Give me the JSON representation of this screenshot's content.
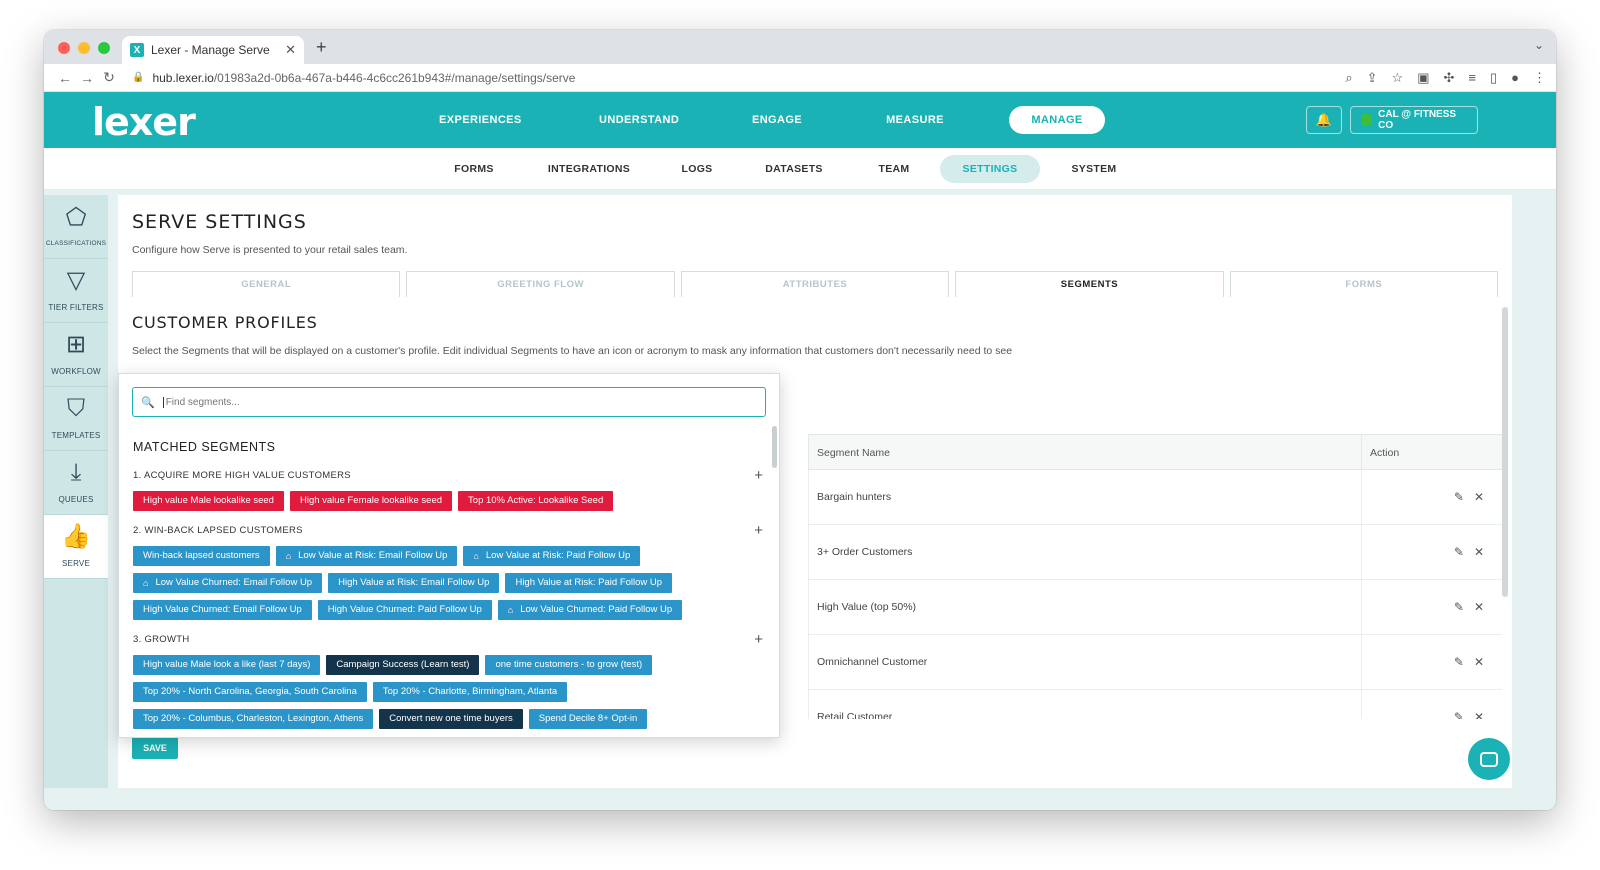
{
  "browser": {
    "tab_title": "Lexer - Manage Serve",
    "favicon_letter": "X",
    "url_host": "hub.lexer.io",
    "url_path": "/01983a2d-0b6a-467a-b446-4c6cc261b943#/manage/settings/serve"
  },
  "app": {
    "logo": "lexer",
    "main_nav": [
      {
        "label": "EXPERIENCES"
      },
      {
        "label": "UNDERSTAND"
      },
      {
        "label": "ENGAGE"
      },
      {
        "label": "MEASURE"
      },
      {
        "label": "MANAGE",
        "active": true
      }
    ],
    "account_name": "CAL @ FITNESS CO",
    "sub_nav": [
      {
        "label": "FORMS"
      },
      {
        "label": "INTEGRATIONS"
      },
      {
        "label": "LOGS"
      },
      {
        "label": "DATASETS"
      },
      {
        "label": "TEAM"
      },
      {
        "label": "SETTINGS",
        "active": true
      },
      {
        "label": "SYSTEM"
      }
    ]
  },
  "sidebar": {
    "items": [
      {
        "label": "CLASSIFICATIONS",
        "icon": "tag-icon"
      },
      {
        "label": "TIER FILTERS",
        "icon": "funnel-icon"
      },
      {
        "label": "WORKFLOW",
        "icon": "workflow-icon"
      },
      {
        "label": "TEMPLATES",
        "icon": "bookmark-icon"
      },
      {
        "label": "QUEUES",
        "icon": "download-tray-icon"
      },
      {
        "label": "SERVE",
        "icon": "thumbs-up-icon",
        "active": true
      }
    ]
  },
  "page": {
    "title": "SERVE SETTINGS",
    "subtitle": "Configure how Serve is presented to your retail sales team.",
    "tabs": [
      {
        "label": "GENERAL"
      },
      {
        "label": "GREETING FLOW"
      },
      {
        "label": "ATTRIBUTES"
      },
      {
        "label": "SEGMENTS",
        "active": true
      },
      {
        "label": "FORMS"
      }
    ],
    "section_title": "CUSTOMER PROFILES",
    "section_sub": "Select the Segments that will be displayed on a customer's profile. Edit individual Segments to have an icon or acronym to mask any information that customers don't necessarily need to see",
    "save_label": "SAVE"
  },
  "table": {
    "col_name": "Segment Name",
    "col_action": "Action",
    "rows": [
      {
        "name": "Bargain hunters"
      },
      {
        "name": "3+ Order Customers"
      },
      {
        "name": "High Value (top 50%)"
      },
      {
        "name": "Omnichannel Customer"
      },
      {
        "name": "Retail Customer"
      }
    ]
  },
  "dropdown": {
    "search_placeholder": "Find segments...",
    "matched_title": "MATCHED SEGMENTS",
    "groups": [
      {
        "title": "1. ACQUIRE MORE HIGH VALUE CUSTOMERS",
        "chips": [
          {
            "label": "High value Male lookalike seed",
            "color": "red"
          },
          {
            "label": "High value Female lookalike seed",
            "color": "red"
          },
          {
            "label": "Top 10% Active: Lookalike Seed",
            "color": "red"
          }
        ]
      },
      {
        "title": "2. WIN-BACK LAPSED CUSTOMERS",
        "chips": [
          {
            "label": "Win-back lapsed customers",
            "color": "blue"
          },
          {
            "label": "Low Value at Risk: Email Follow Up",
            "color": "blue",
            "icon": true
          },
          {
            "label": "Low Value at Risk: Paid Follow Up",
            "color": "blue",
            "icon": true
          },
          {
            "label": "Low Value Churned: Email Follow Up",
            "color": "blue",
            "icon": true
          },
          {
            "label": "High Value at Risk: Email Follow Up",
            "color": "blue"
          },
          {
            "label": "High Value at Risk: Paid Follow Up",
            "color": "blue"
          },
          {
            "label": "High Value Churned: Email Follow Up",
            "color": "blue"
          },
          {
            "label": "High Value Churned: Paid Follow Up",
            "color": "blue"
          },
          {
            "label": "Low Value Churned: Paid Follow Up",
            "color": "blue",
            "icon": true
          }
        ]
      },
      {
        "title": "3. GROWTH",
        "chips": [
          {
            "label": "High value Male look a like (last 7 days)",
            "color": "blue"
          },
          {
            "label": "Campaign Success (Learn test)",
            "color": "navy"
          },
          {
            "label": "one time customers - to grow (test)",
            "color": "blue"
          },
          {
            "label": "Top 20% - North Carolina, Georgia, South Carolina",
            "color": "blue"
          },
          {
            "label": "Top 20% - Charlotte, Birmingham, Atlanta",
            "color": "blue"
          },
          {
            "label": "Top 20% - Columbus, Charleston, Lexington, Athens",
            "color": "blue"
          },
          {
            "label": "Convert new one time buyers",
            "color": "navy"
          },
          {
            "label": "Spend Decile 8+ Opt-in",
            "color": "blue"
          }
        ]
      }
    ]
  },
  "colors": {
    "brand": "#1ab2b5",
    "chip_red": "#e01b3d",
    "chip_blue": "#2b95c9",
    "chip_navy": "#13344b"
  }
}
